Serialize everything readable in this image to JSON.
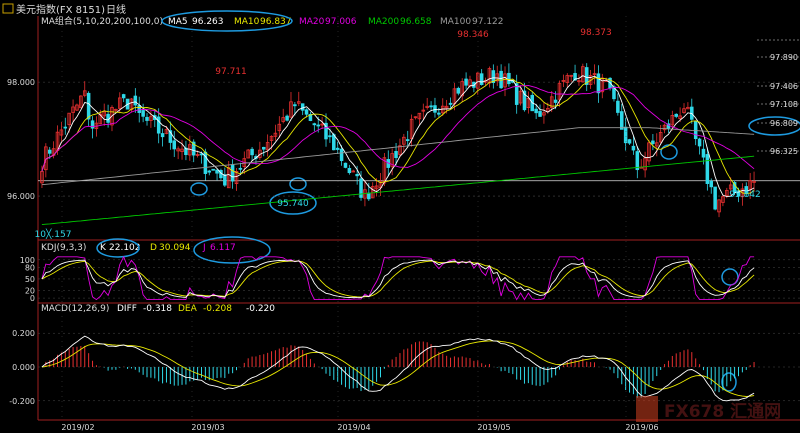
{
  "window": {
    "title": "美元指数(FX 8151)",
    "period": "日线",
    "icon": "chart-icon"
  },
  "colors": {
    "bg": "#000000",
    "up": "#e83030",
    "down": "#2fd8e8",
    "ma5": "#ffffff",
    "ma10": "#e8e800",
    "ma20": "#e000e0",
    "ma200": "#00c800",
    "ma100": "#9a9a9a",
    "grid": "#4a4a4a",
    "axis": "#a02020",
    "annotation": "#1e9be0"
  },
  "chart_data": [
    {
      "type": "candlestick",
      "title": "MA组合(5,10,20,200,100,0)",
      "indicators": [
        {
          "name": "MA5",
          "value": "96.263"
        },
        {
          "name": "MA10",
          "value": "96.837"
        },
        {
          "name": "MA20",
          "value": "97.006"
        },
        {
          "name": "MA200",
          "value": "96.658"
        },
        {
          "name": "MA100",
          "value": "97.122"
        }
      ],
      "y_ticks": [
        "98.000",
        "96.000"
      ],
      "right_labels": [
        "97.890",
        "97.406",
        "97.108",
        "96.809",
        "96.325"
      ],
      "annotations": [
        {
          "label": "98.346",
          "kind": "high"
        },
        {
          "label": "98.373",
          "kind": "high"
        },
        {
          "label": "97.711",
          "kind": "high"
        },
        {
          "label": "95.740",
          "kind": "low"
        },
        {
          "label": "95.842",
          "kind": "low"
        },
        {
          "label": "10╳.157",
          "kind": "low"
        }
      ],
      "ylim": [
        95.3,
        98.95
      ],
      "grid": true,
      "segments": [
        [
          96.5,
          97.8,
          12
        ],
        [
          97.2,
          97.7,
          12
        ],
        [
          97.5,
          96.9,
          12
        ],
        [
          96.9,
          96.3,
          12
        ],
        [
          96.3,
          96.9,
          10
        ],
        [
          96.9,
          97.6,
          8
        ],
        [
          97.6,
          96.9,
          10
        ],
        [
          96.9,
          96.0,
          8
        ],
        [
          96.0,
          97.2,
          12
        ],
        [
          97.2,
          97.9,
          12
        ],
        [
          97.9,
          98.15,
          10
        ],
        [
          98.15,
          97.4,
          10
        ],
        [
          97.4,
          98.2,
          10
        ],
        [
          98.2,
          97.9,
          8
        ],
        [
          97.9,
          96.5,
          8
        ],
        [
          96.5,
          96.9,
          4
        ],
        [
          96.9,
          97.6,
          8
        ],
        [
          97.6,
          95.9,
          8
        ],
        [
          95.9,
          96.25,
          10
        ]
      ],
      "start": 95.6
    },
    {
      "type": "line",
      "title": "KDJ(9,3,3)",
      "indicators": [
        {
          "name": "K",
          "value": "22.102"
        },
        {
          "name": "D",
          "value": "30.094"
        },
        {
          "name": "J",
          "value": "6.117"
        }
      ],
      "y_ticks": [
        "100",
        "80",
        "50",
        "20",
        "0"
      ],
      "ylim": [
        -5,
        110
      ],
      "grid": true
    },
    {
      "type": "bar",
      "title": "MACD(12,26,9)",
      "indicators": [
        {
          "name": "DIFF",
          "value": "-0.318"
        },
        {
          "name": "DEA",
          "value": "-0.208"
        },
        {
          "name": "MACD",
          "value": "-0.220"
        }
      ],
      "y_ticks": [
        "0.200",
        "0.000",
        "-0.200"
      ],
      "ylim": [
        -0.29,
        0.29
      ],
      "grid": true
    }
  ],
  "x_axis": {
    "ticks": [
      "2019/02",
      "2019/03",
      "2019/04",
      "2019/05",
      "2019/06"
    ]
  },
  "watermark": {
    "text": "FX678 汇通网"
  }
}
